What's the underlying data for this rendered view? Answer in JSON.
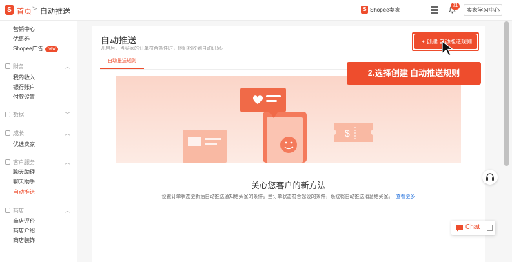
{
  "breadcrumb": {
    "home": "首页",
    "separator": ">",
    "current": "自动推送"
  },
  "header": {
    "seller_label": "Shopee卖家",
    "notification_count": "21",
    "user_menu": "卖家学习中心"
  },
  "sidebar": {
    "items": [
      {
        "label": "营销中心"
      },
      {
        "label": "优惠券"
      },
      {
        "label": "Shopee广告",
        "badge": "New"
      },
      {
        "section": "财务"
      },
      {
        "label": "我的收入"
      },
      {
        "label": "银行账户"
      },
      {
        "label": "付款设置"
      },
      {
        "section": "数据"
      },
      {
        "section": "成长"
      },
      {
        "label": "优选卖家"
      },
      {
        "section": "客户服务"
      },
      {
        "label": "聊天助理"
      },
      {
        "label": "聊天助手"
      },
      {
        "label": "自动推送",
        "active": true
      },
      {
        "section": "商店"
      },
      {
        "label": "商店评价"
      },
      {
        "label": "商店介绍"
      },
      {
        "label": "商店装饰"
      }
    ]
  },
  "main": {
    "title": "自动推送",
    "subtitle": "开启后，当买家的订单符合条件时，他们将收到自动讯息。",
    "create_button": "+ 创建 自动推送规则",
    "tab": "自动推送规则",
    "heading": "关心您客户的新方法",
    "description": "设置订单状态更新后自动推送通知给买家的条件。当订单状态符合您设的条件，系统将自动推送消息给买家。",
    "more_link": "查看更多"
  },
  "callout": {
    "text": "2.选择创建 自动推送规则"
  },
  "chat": {
    "label": "Chat"
  },
  "colors": {
    "accent": "#ee4d2d",
    "link": "#2673dd"
  }
}
